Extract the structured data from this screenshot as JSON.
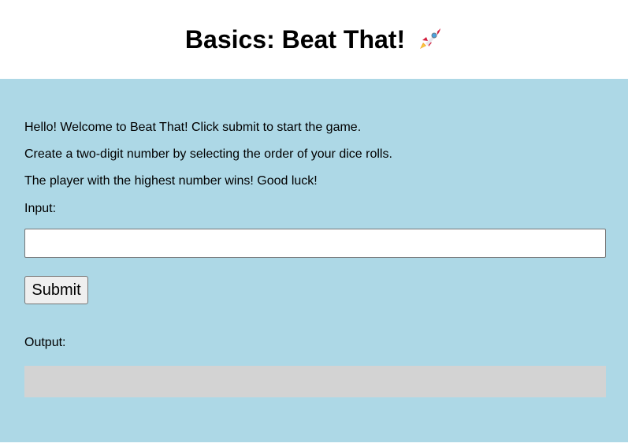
{
  "header": {
    "title": "Basics: Beat That!",
    "icon": "rocket-icon"
  },
  "instructions": {
    "line1": "Hello! Welcome to Beat That! Click submit to start the game.",
    "line2": "Create a two-digit number by selecting the order of your dice rolls.",
    "line3": "The player with the highest number wins! Good luck!"
  },
  "input": {
    "label": "Input:",
    "value": "",
    "placeholder": ""
  },
  "submit": {
    "label": "Submit"
  },
  "output": {
    "label": "Output:",
    "value": ""
  },
  "colors": {
    "container_bg": "#add8e6",
    "output_bg": "#d3d3d3"
  }
}
